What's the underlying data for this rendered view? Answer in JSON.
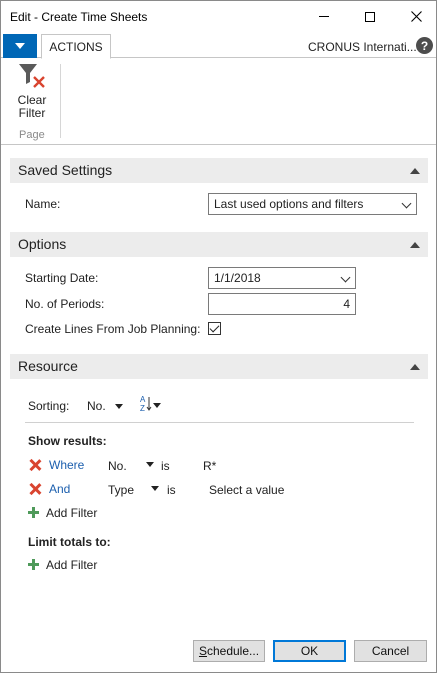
{
  "window": {
    "title": "Edit - Create Time Sheets"
  },
  "ribbon": {
    "tab_actions": "ACTIONS",
    "company": "CRONUS Internati...",
    "help_glyph": "?",
    "clear_filter_label": "Clear Filter",
    "group_label": "Page"
  },
  "saved_settings": {
    "title": "Saved Settings",
    "name_label": "Name:",
    "name_value": "Last used options and filters"
  },
  "options": {
    "title": "Options",
    "starting_date_label": "Starting Date:",
    "starting_date_value": "1/1/2018",
    "periods_label": "No. of Periods:",
    "periods_value": "4",
    "create_lines_label": "Create Lines From Job Planning:",
    "create_lines_checked": true
  },
  "resource": {
    "title": "Resource",
    "sorting_label": "Sorting:",
    "sorting_field": "No.",
    "show_results_label": "Show results:",
    "filters": [
      {
        "conjunction": "Where",
        "field": "No.",
        "operator": "is",
        "value": "R*"
      },
      {
        "conjunction": "And",
        "field": "Type",
        "operator": "is",
        "value": "Select a value"
      }
    ],
    "add_filter_label": "Add Filter",
    "limit_totals_label": "Limit totals to:",
    "add_filter_label_2": "Add Filter"
  },
  "footer": {
    "schedule": "Schedule...",
    "ok": "OK",
    "cancel": "Cancel"
  }
}
